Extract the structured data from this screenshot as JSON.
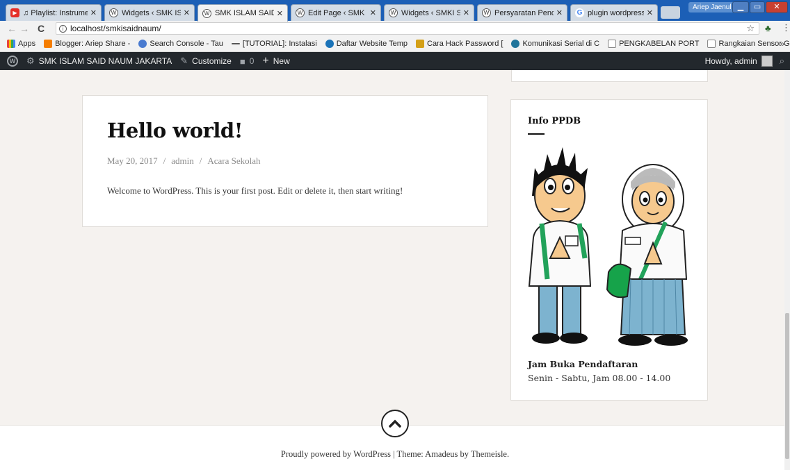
{
  "browser": {
    "tabs": [
      {
        "title": "♫ Playlist: Instrume",
        "icon": "youtube-icon"
      },
      {
        "title": "Widgets ‹ SMK ISLA",
        "icon": "wordpress-icon"
      },
      {
        "title": "SMK ISLAM SAID N/",
        "icon": "wordpress-icon",
        "active": true
      },
      {
        "title": "Edit Page ‹ SMK ISL/",
        "icon": "wordpress-icon"
      },
      {
        "title": "Widgets ‹ SMKI Said",
        "icon": "wordpress-icon"
      },
      {
        "title": "Persyaratan Pendaft",
        "icon": "wordpress-icon"
      },
      {
        "title": "plugin wordpress ad",
        "icon": "google-icon"
      }
    ],
    "profile_name": "Ariep Jaenul",
    "url": "localhost/smkisaidnaum/",
    "bookmarks": [
      {
        "label": "Apps",
        "icon": "apps-grid-icon",
        "color": "#e8453c"
      },
      {
        "label": "Blogger: Ariep Share -",
        "icon": "blogger-icon",
        "color": "#f57d00"
      },
      {
        "label": "Search Console - Tau",
        "icon": "search-console-icon",
        "color": "#4a7bd0"
      },
      {
        "label": "[TUTORIAL]: Instalasi",
        "icon": "dash-icon",
        "color": "#555555"
      },
      {
        "label": "Daftar Website Temp",
        "icon": "globe-icon",
        "color": "#1a73b8"
      },
      {
        "label": "Cara Hack Password [",
        "icon": "bookmark-icon",
        "color": "#d4a017"
      },
      {
        "label": "Komunikasi Serial di C",
        "icon": "wordpress-icon",
        "color": "#21759b"
      },
      {
        "label": "PENGKABELAN PORT",
        "icon": "page-icon",
        "color": "#888888"
      },
      {
        "label": "Rangkaian Sensor Ge",
        "icon": "page-icon",
        "color": "#888888"
      }
    ],
    "more_bookmarks": "»"
  },
  "adminbar": {
    "site_name": "SMK ISLAM SAID NAUM JAKARTA",
    "customize": "Customize",
    "comments_count": "0",
    "new_label": "New",
    "howdy": "Howdy, admin"
  },
  "post": {
    "title": "Hello world!",
    "date": "May 20, 2017",
    "author": "admin",
    "category": "Acara Sekolah",
    "meta_sep": "/",
    "excerpt": "Welcome to WordPress. This is your first post. Edit or delete it, then start writing!"
  },
  "widget": {
    "title": "Info PPDB",
    "subtitle": "Jam Buka Pendaftaran",
    "text": "Senin - Sabtu, Jam 08.00 - 14.00"
  },
  "footer": {
    "text": "Proudly powered by WordPress | Theme: Amadeus by Themeisle."
  },
  "colors": {
    "adminbar": "#23282d",
    "page_bg": "#f5f2ef",
    "tabstrip": "#1c5fb6"
  }
}
